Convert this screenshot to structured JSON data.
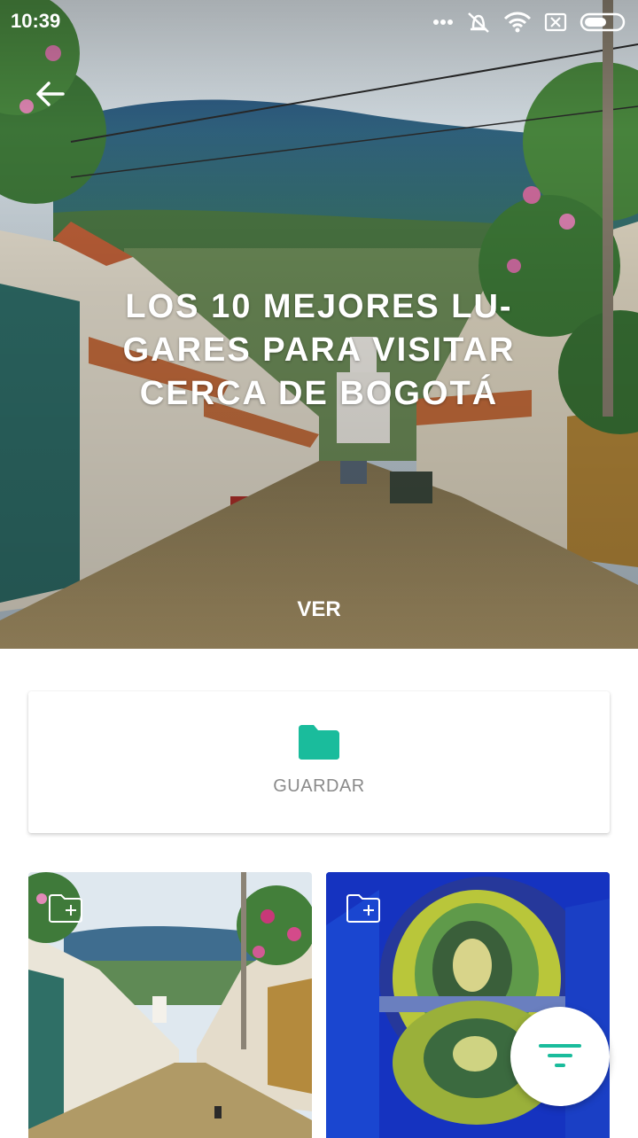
{
  "status_bar": {
    "time": "10:39",
    "icons": [
      "more-dots-icon",
      "alarm-off-icon",
      "wifi-icon",
      "no-sim-icon",
      "battery-icon"
    ]
  },
  "header": {
    "back_icon": "arrow-left-icon"
  },
  "hero": {
    "title": "LOS 10 MEJORES LU-GARES PARA VISITAR CERCA DE BOGOTÁ",
    "title_lines": [
      "LOS 10 MEJORES LU-",
      "GARES PARA VISITAR",
      "CERCA DE BOGOTÁ"
    ],
    "action_label": "VER"
  },
  "save_card": {
    "icon": "folder-icon",
    "label": "GUARDAR",
    "accent_color": "#1ABC9C"
  },
  "places": [
    {
      "image": "colonial-street-photo",
      "save_icon": "folder-plus-icon"
    },
    {
      "image": "salt-cathedral-tunnel-photo",
      "save_icon": "folder-plus-icon"
    }
  ],
  "fab": {
    "icon": "filter-icon",
    "accent_color": "#1ABC9C"
  }
}
